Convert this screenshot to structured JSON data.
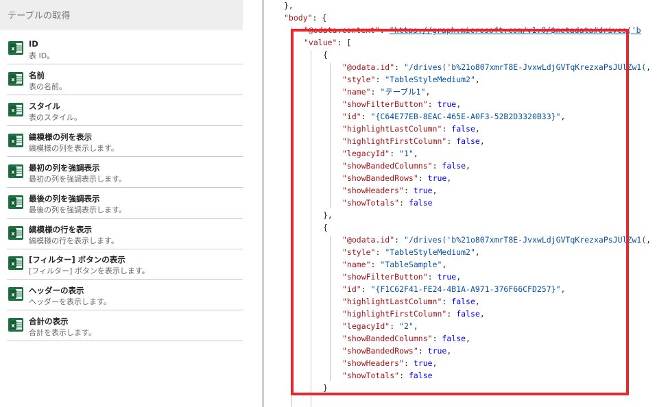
{
  "left_panel": {
    "header": "テーブルの取得",
    "items": [
      {
        "title": "ID",
        "desc": "表 ID。"
      },
      {
        "title": "名前",
        "desc": "表の名前。"
      },
      {
        "title": "スタイル",
        "desc": "表のスタイル。"
      },
      {
        "title": "縞模様の列を表示",
        "desc": "縞模様の列を表示します。"
      },
      {
        "title": "最初の列を強調表示",
        "desc": "最初の列を強調表示します。"
      },
      {
        "title": "最後の列を強調表示",
        "desc": "最後の列を強調表示します。"
      },
      {
        "title": "縞模様の行を表示",
        "desc": "縞模様の行を表示します。"
      },
      {
        "title": "[フィルター] ボタンの表示",
        "desc": "[フィルター] ボタンを表示します。"
      },
      {
        "title": "ヘッダーの表示",
        "desc": "ヘッダーを表示します。"
      },
      {
        "title": "合計の表示",
        "desc": "合計を表示します。"
      }
    ]
  },
  "code": {
    "top_close": "},",
    "body_key": "\"body\"",
    "odata_context_key": "\"@odata.context\"",
    "odata_context_val": "\"https://graph.microsoft.com/v1.0/$metadata#drives('b",
    "value_key": "\"value\"",
    "objects": [
      {
        "odata_id": "\"/drives('b%21o807xmrT8E-JvxwLdjGVTqKrezxaPsJUlZw1(",
        "style": "\"TableStyleMedium2\"",
        "name": "\"テーブル1\"",
        "showFilterButton": "true",
        "id": "\"{C64E77EB-8EAC-465E-A0F3-52B2D3320B33}\"",
        "highlightLastColumn": "false",
        "highlightFirstColumn": "false",
        "legacyId": "\"1\"",
        "showBandedColumns": "false",
        "showBandedRows": "true",
        "showHeaders": "true",
        "showTotals": "false"
      },
      {
        "odata_id": "\"/drives('b%21o807xmrT8E-JvxwLdjGVTqKrezxaPsJUlZw1(",
        "style": "\"TableStyleMedium2\"",
        "name": "\"TableSample\"",
        "showFilterButton": "true",
        "id": "\"{F1C62F41-FE24-4B1A-A971-376F66CFD257}\"",
        "highlightLastColumn": "false",
        "highlightFirstColumn": "false",
        "legacyId": "\"2\"",
        "showBandedColumns": "false",
        "showBandedRows": "true",
        "showHeaders": "true",
        "showTotals": "false"
      }
    ]
  },
  "colors": {
    "excel_green": "#1e7145",
    "highlight_red": "#e8262d",
    "json_key": "#a31515",
    "json_string": "#0451a5",
    "json_bool": "#0000ff"
  },
  "icons": {
    "item_icon": "excel-icon"
  }
}
